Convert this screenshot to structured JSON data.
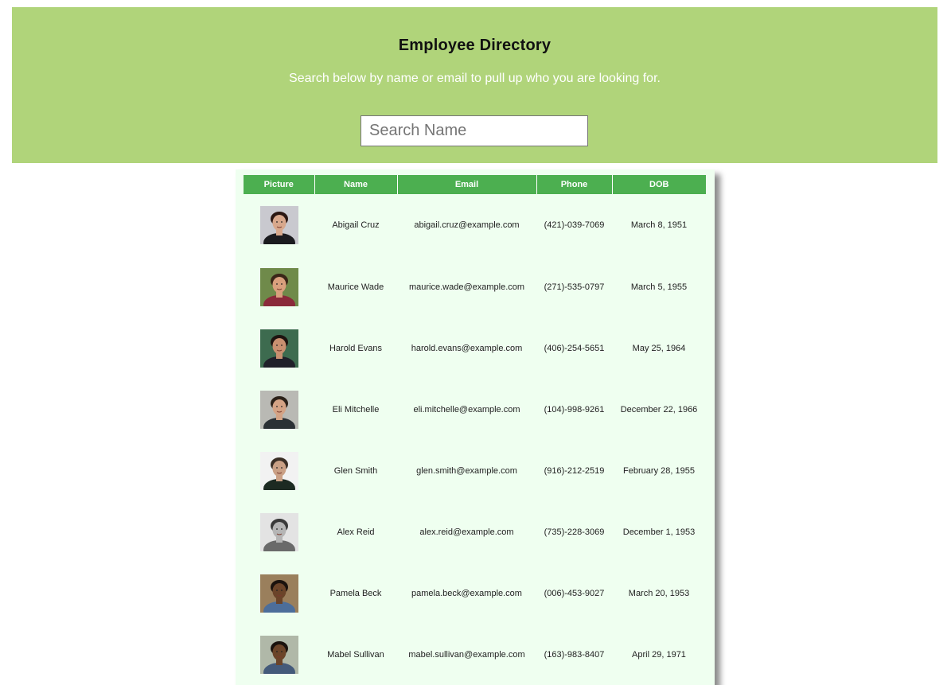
{
  "header": {
    "title": "Employee Directory",
    "subtitle": "Search below by name or email to pull up who you are looking for.",
    "search_placeholder": "Search Name"
  },
  "table": {
    "columns": [
      "Picture",
      "Name",
      "Email",
      "Phone",
      "DOB"
    ],
    "rows": [
      {
        "name": "Abigail Cruz",
        "email": "abigail.cruz@example.com",
        "phone": "(421)-039-7069",
        "dob": "March 8, 1951",
        "avatar": "portrait-woman-icon"
      },
      {
        "name": "Maurice Wade",
        "email": "maurice.wade@example.com",
        "phone": "(271)-535-0797",
        "dob": "March 5, 1955",
        "avatar": "portrait-man-icon"
      },
      {
        "name": "Harold Evans",
        "email": "harold.evans@example.com",
        "phone": "(406)-254-5651",
        "dob": "May 25, 1964",
        "avatar": "portrait-man-icon"
      },
      {
        "name": "Eli Mitchelle",
        "email": "eli.mitchelle@example.com",
        "phone": "(104)-998-9261",
        "dob": "December 22, 1966",
        "avatar": "portrait-man-icon"
      },
      {
        "name": "Glen Smith",
        "email": "glen.smith@example.com",
        "phone": "(916)-212-2519",
        "dob": "February 28, 1955",
        "avatar": "portrait-man-icon"
      },
      {
        "name": "Alex Reid",
        "email": "alex.reid@example.com",
        "phone": "(735)-228-3069",
        "dob": "December 1, 1953",
        "avatar": "portrait-man-icon"
      },
      {
        "name": "Pamela Beck",
        "email": "pamela.beck@example.com",
        "phone": "(006)-453-9027",
        "dob": "March 20, 1953",
        "avatar": "portrait-woman-icon"
      },
      {
        "name": "Mabel Sullivan",
        "email": "mabel.sullivan@example.com",
        "phone": "(163)-983-8407",
        "dob": "April 29, 1971",
        "avatar": "portrait-woman-icon"
      }
    ]
  },
  "colors": {
    "header_bg": "#b0d47a",
    "table_header_bg": "#4caf50",
    "table_bg": "#effff0"
  }
}
